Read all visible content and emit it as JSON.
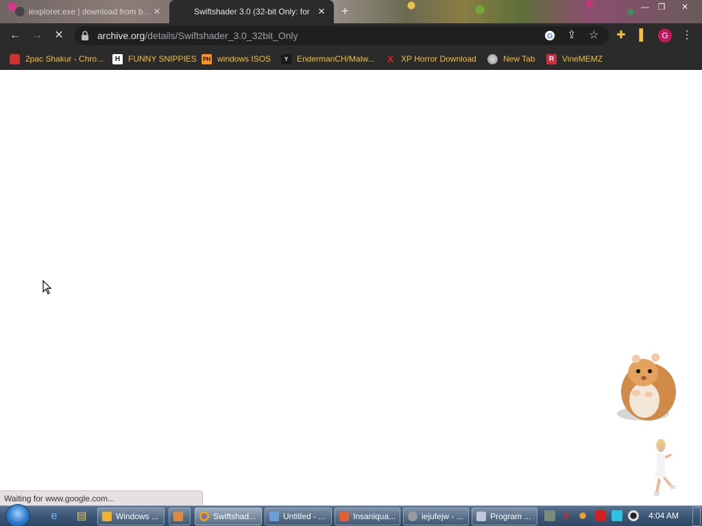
{
  "browser": {
    "tabs": [
      {
        "title": "iexplorer.exe | download from bas",
        "active": false
      },
      {
        "title": "Swiftshader 3.0 (32-bit Only: for",
        "active": true
      }
    ],
    "new_tab_label": "+",
    "url": {
      "host": "archive.org",
      "path": "/details/Swiftshader_3.0_32bit_Only"
    },
    "profile_initial": "G",
    "bookmarks": [
      {
        "label": "2pac Shakur - Chro...",
        "icon": "bookmark-icon"
      },
      {
        "label": "FUNNY SNIPPIES",
        "icon": "H",
        "color": "#ffffff"
      },
      {
        "label": "windows ISOS",
        "icon": "PH",
        "color": "#f7931e"
      },
      {
        "label": "EndermanCH/Malw...",
        "icon": "Y",
        "color": "#1a1a1a"
      },
      {
        "label": "XP Horror Download",
        "icon": "X",
        "color": "#e0201b"
      },
      {
        "label": "New Tab",
        "icon": "globe-icon"
      },
      {
        "label": "VineMEMZ",
        "icon": "R",
        "color": "#d12a3a"
      }
    ],
    "status_text": "Waiting for www.google.com..."
  },
  "taskbar": {
    "items": [
      {
        "label": "Windows ...",
        "icon_color": "#f0b030"
      },
      {
        "label": "Swiftshad...",
        "icon_color": "#4285f4",
        "active": true
      },
      {
        "label": "Untitled - ...",
        "icon_color": "#6aa0d8"
      },
      {
        "label": "Insaniqua...",
        "icon_color": "#e06030"
      },
      {
        "label": "iejufejw - ...",
        "icon_color": "#9a9a9a"
      },
      {
        "label": "Program ...",
        "icon_color": "#c0c8d8"
      }
    ],
    "clock": "4:04 AM"
  },
  "colors": {
    "accent": "#f0c040",
    "toolbar": "#2b2b2b",
    "profile": "#c2185b"
  }
}
